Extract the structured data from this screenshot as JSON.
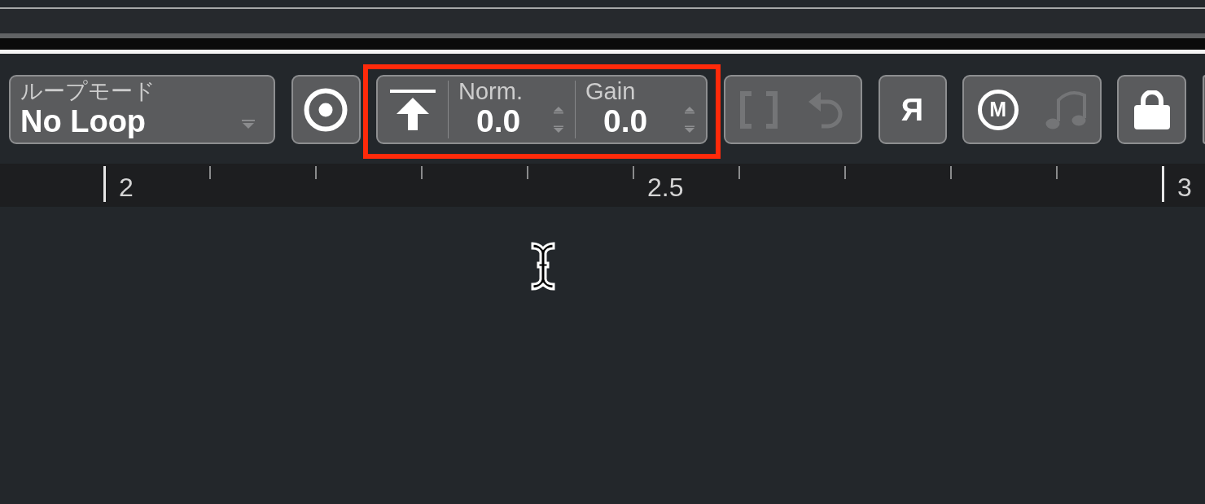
{
  "toolbar": {
    "loop_mode": {
      "label": "ループモード",
      "value": "No Loop"
    },
    "buttons": [
      {
        "kind": "target",
        "disabled": false
      },
      {
        "kind": "normalize",
        "highlighted": true,
        "fields": [
          {
            "label": "Norm.",
            "value": "0.0"
          },
          {
            "label": "Gain",
            "value": "0.0"
          }
        ]
      },
      {
        "kind": "pair",
        "icons": [
          {
            "kind": "brackets",
            "disabled": true
          },
          {
            "kind": "undo",
            "disabled": true
          }
        ]
      },
      {
        "kind": "glyph",
        "glyph": "Я",
        "disabled": false
      },
      {
        "kind": "pair",
        "icons": [
          {
            "kind": "circled-letter",
            "letter": "M",
            "disabled": false
          },
          {
            "kind": "music-note",
            "disabled": true
          }
        ]
      },
      {
        "kind": "lock",
        "disabled": false
      },
      {
        "kind": "cut-off"
      }
    ]
  },
  "ruler": {
    "ticks": [
      {
        "major": true,
        "label": "2"
      },
      {
        "major": false
      },
      {
        "major": false
      },
      {
        "major": false
      },
      {
        "major": false
      },
      {
        "major": false,
        "label": "2.5"
      },
      {
        "major": false
      },
      {
        "major": false
      },
      {
        "major": false
      },
      {
        "major": false
      },
      {
        "major": true,
        "label": "3"
      }
    ]
  }
}
